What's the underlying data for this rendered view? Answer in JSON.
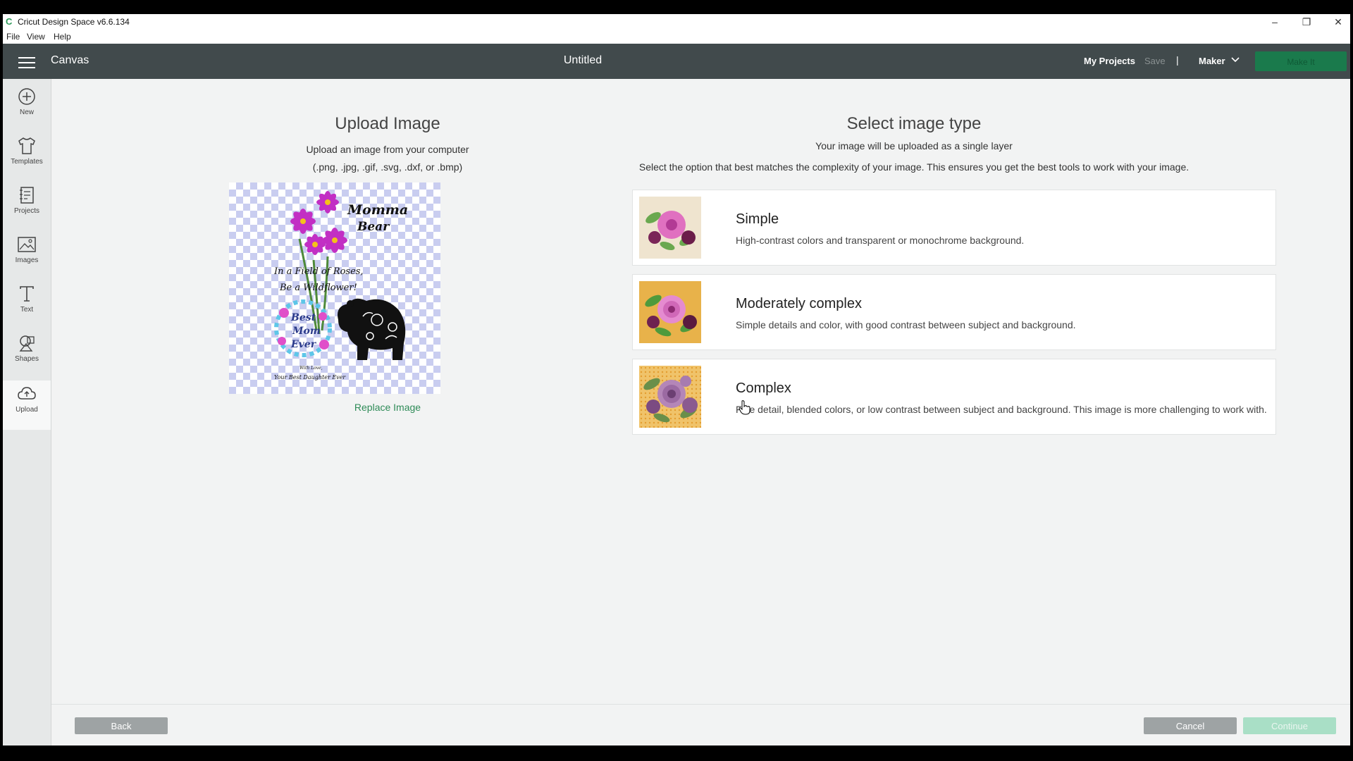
{
  "window": {
    "app_title": "Cricut Design Space  v6.6.134",
    "controls": {
      "minimize": "–",
      "restore": "❐",
      "close": "✕"
    }
  },
  "menu": {
    "items": [
      "File",
      "View",
      "Help"
    ]
  },
  "header": {
    "section": "Canvas",
    "document_title": "Untitled",
    "my_projects": "My Projects",
    "save": "Save",
    "separator": "|",
    "machine": "Maker",
    "make_it": "Make It"
  },
  "sidebar": {
    "items": [
      {
        "label": "New",
        "icon": "plus-circle-icon"
      },
      {
        "label": "Templates",
        "icon": "shirt-icon"
      },
      {
        "label": "Projects",
        "icon": "projects-icon"
      },
      {
        "label": "Images",
        "icon": "image-icon"
      },
      {
        "label": "Text",
        "icon": "text-icon"
      },
      {
        "label": "Shapes",
        "icon": "shapes-icon"
      },
      {
        "label": "Upload",
        "icon": "cloud-upload-icon"
      }
    ]
  },
  "upload": {
    "title": "Upload Image",
    "line1": "Upload an image from your computer",
    "line2": "(.png, .jpg, .gif, .svg, .dxf, or .bmp)",
    "replace_link": "Replace Image",
    "preview_text": {
      "heading1": "Momma",
      "heading2": "Bear",
      "line1": "In a Field of Roses,",
      "line2": "Be a Wildflower!",
      "badge1": "Best",
      "badge2": "Mom",
      "badge3": "Ever",
      "small1": "With Love,",
      "small2": "Your Best Daughter Ever"
    }
  },
  "select_type": {
    "title": "Select image type",
    "subtitle": "Your image will be uploaded as a single layer",
    "description": "Select the option that best matches the complexity of your image. This ensures you get the best tools to work with your image.",
    "options": [
      {
        "title": "Simple",
        "desc": "High-contrast colors and transparent or monochrome background.",
        "thumb_bg": "#efe4cf"
      },
      {
        "title": "Moderately complex",
        "desc": "Simple details and color, with good contrast between subject and background.",
        "thumb_bg": "#e8b24a"
      },
      {
        "title": "Complex",
        "desc": "Fine detail, blended colors, or low contrast between subject and background. This image is more challenging to work with.",
        "thumb_bg": "#f0c36a"
      }
    ]
  },
  "footer": {
    "back": "Back",
    "cancel": "Cancel",
    "continue": "Continue"
  },
  "colors": {
    "header_bg": "#414a4c",
    "accent_green": "#2e8b57",
    "checker": "#c9cdf0"
  }
}
